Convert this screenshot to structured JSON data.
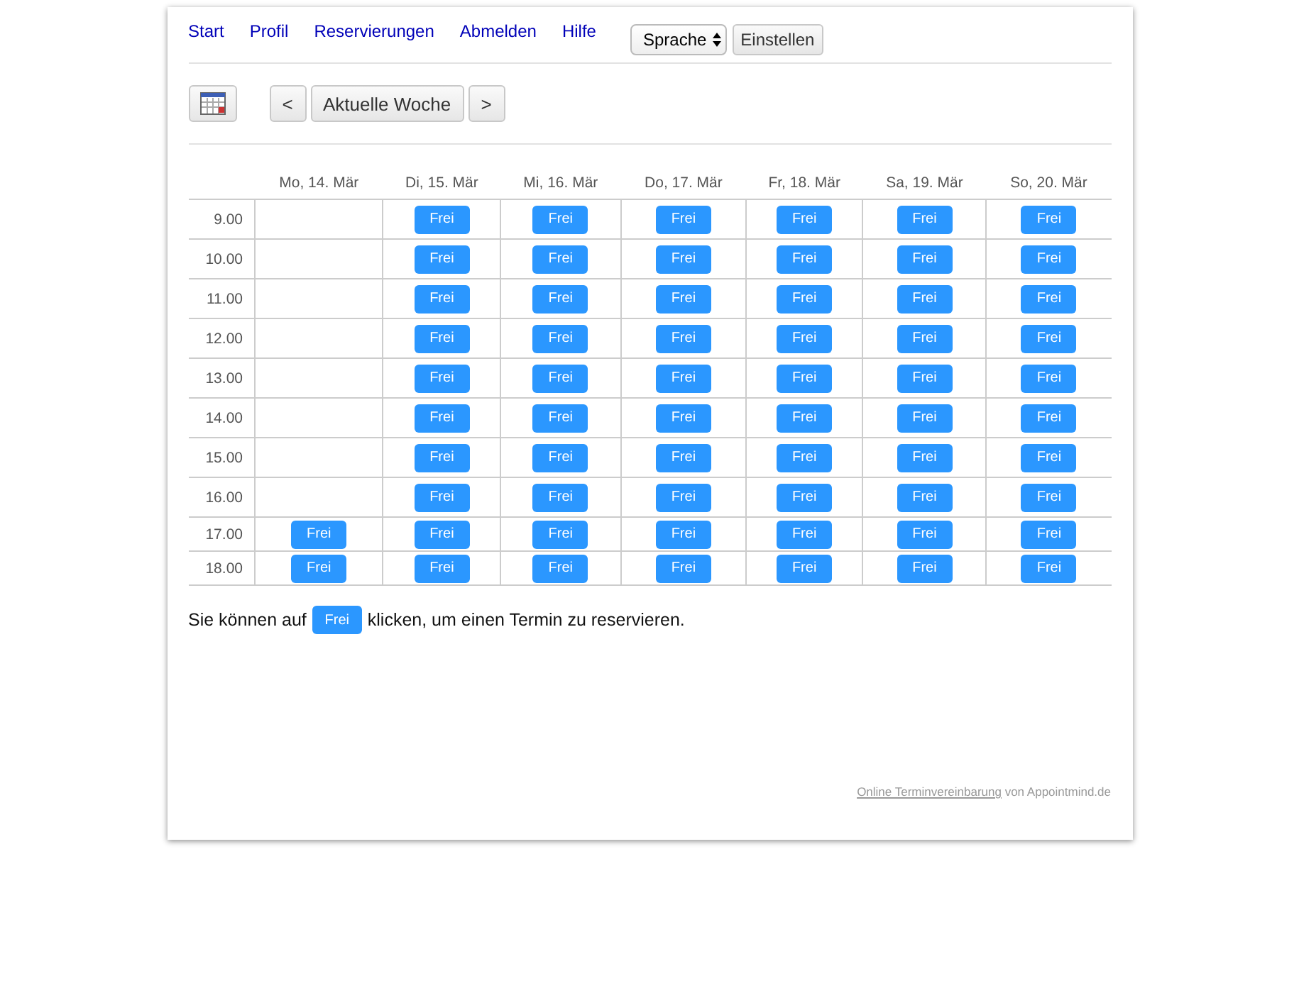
{
  "nav": {
    "links": [
      "Start",
      "Profil",
      "Reservierungen",
      "Abmelden",
      "Hilfe"
    ],
    "language_select": "Sprache",
    "apply_button": "Einstellen"
  },
  "week_nav": {
    "prev": "<",
    "current": "Aktuelle Woche",
    "next": ">"
  },
  "calendar": {
    "days": [
      "Mo, 14. Mär",
      "Di, 15. Mär",
      "Mi, 16. Mär",
      "Do, 17. Mär",
      "Fr, 18. Mär",
      "Sa, 19. Mär",
      "So, 20. Mär"
    ],
    "rows": [
      {
        "time": "9.00",
        "slots": [
          {
            "kind": "empty"
          },
          {
            "kind": "free",
            "label": "Frei"
          },
          {
            "kind": "free",
            "label": "Frei"
          },
          {
            "kind": "free",
            "label": "Frei"
          },
          {
            "kind": "free",
            "label": "Frei"
          },
          {
            "kind": "free",
            "label": "Frei"
          },
          {
            "kind": "free",
            "label": "Frei"
          }
        ]
      },
      {
        "time": "10.00",
        "slots": [
          {
            "kind": "empty"
          },
          {
            "kind": "free",
            "label": "Frei"
          },
          {
            "kind": "free",
            "label": "Frei"
          },
          {
            "kind": "free",
            "label": "Frei"
          },
          {
            "kind": "free",
            "label": "Frei"
          },
          {
            "kind": "free",
            "label": "Frei"
          },
          {
            "kind": "free",
            "label": "Frei"
          }
        ]
      },
      {
        "time": "11.00",
        "slots": [
          {
            "kind": "empty"
          },
          {
            "kind": "free",
            "label": "Frei"
          },
          {
            "kind": "free",
            "label": "Frei"
          },
          {
            "kind": "free",
            "label": "Frei"
          },
          {
            "kind": "free",
            "label": "Frei"
          },
          {
            "kind": "free",
            "label": "Frei"
          },
          {
            "kind": "free",
            "label": "Frei"
          }
        ]
      },
      {
        "time": "12.00",
        "slots": [
          {
            "kind": "empty"
          },
          {
            "kind": "free",
            "label": "Frei"
          },
          {
            "kind": "free",
            "label": "Frei"
          },
          {
            "kind": "free",
            "label": "Frei"
          },
          {
            "kind": "free",
            "label": "Frei"
          },
          {
            "kind": "free",
            "label": "Frei"
          },
          {
            "kind": "free",
            "label": "Frei"
          }
        ]
      },
      {
        "time": "13.00",
        "slots": [
          {
            "kind": "empty"
          },
          {
            "kind": "free",
            "label": "Frei"
          },
          {
            "kind": "free",
            "label": "Frei"
          },
          {
            "kind": "free",
            "label": "Frei"
          },
          {
            "kind": "free",
            "label": "Frei"
          },
          {
            "kind": "free",
            "label": "Frei"
          },
          {
            "kind": "free",
            "label": "Frei"
          }
        ]
      },
      {
        "time": "14.00",
        "slots": [
          {
            "kind": "empty"
          },
          {
            "kind": "free",
            "label": "Frei"
          },
          {
            "kind": "free",
            "label": "Frei"
          },
          {
            "kind": "free",
            "label": "Frei"
          },
          {
            "kind": "free",
            "label": "Frei"
          },
          {
            "kind": "free",
            "label": "Frei"
          },
          {
            "kind": "free",
            "label": "Frei"
          }
        ]
      },
      {
        "time": "15.00",
        "slots": [
          {
            "kind": "empty"
          },
          {
            "kind": "free",
            "label": "Frei"
          },
          {
            "kind": "free",
            "label": "Frei"
          },
          {
            "kind": "free",
            "label": "Frei"
          },
          {
            "kind": "free",
            "label": "Frei"
          },
          {
            "kind": "free",
            "label": "Frei"
          },
          {
            "kind": "free",
            "label": "Frei"
          }
        ]
      },
      {
        "time": "16.00",
        "slots": [
          {
            "kind": "empty"
          },
          {
            "kind": "free",
            "label": "Frei"
          },
          {
            "kind": "free",
            "label": "Frei"
          },
          {
            "kind": "free",
            "label": "Frei"
          },
          {
            "kind": "free",
            "label": "Frei"
          },
          {
            "kind": "free",
            "label": "Frei"
          },
          {
            "kind": "free",
            "label": "Frei"
          }
        ]
      },
      {
        "time": "17.00",
        "slots": [
          {
            "kind": "free",
            "label": "Frei"
          },
          {
            "kind": "free",
            "label": "Frei"
          },
          {
            "kind": "free",
            "label": "Frei"
          },
          {
            "kind": "free",
            "label": "Frei"
          },
          {
            "kind": "free",
            "label": "Frei"
          },
          {
            "kind": "free",
            "label": "Frei"
          },
          {
            "kind": "free",
            "label": "Frei"
          }
        ]
      },
      {
        "time": "18.00",
        "slots": [
          {
            "kind": "free",
            "label": "Frei"
          },
          {
            "kind": "free",
            "label": "Frei"
          },
          {
            "kind": "free",
            "label": "Frei"
          },
          {
            "kind": "free",
            "label": "Frei"
          },
          {
            "kind": "free",
            "label": "Frei"
          },
          {
            "kind": "free",
            "label": "Frei"
          },
          {
            "kind": "free",
            "label": "Frei"
          }
        ]
      }
    ]
  },
  "hint": {
    "before": "Sie können auf",
    "button": "Frei",
    "after": "klicken, um einen Termin zu reservieren."
  },
  "footer": {
    "link": "Online Terminvereinbarung",
    "text": "von Appointmind.de"
  }
}
